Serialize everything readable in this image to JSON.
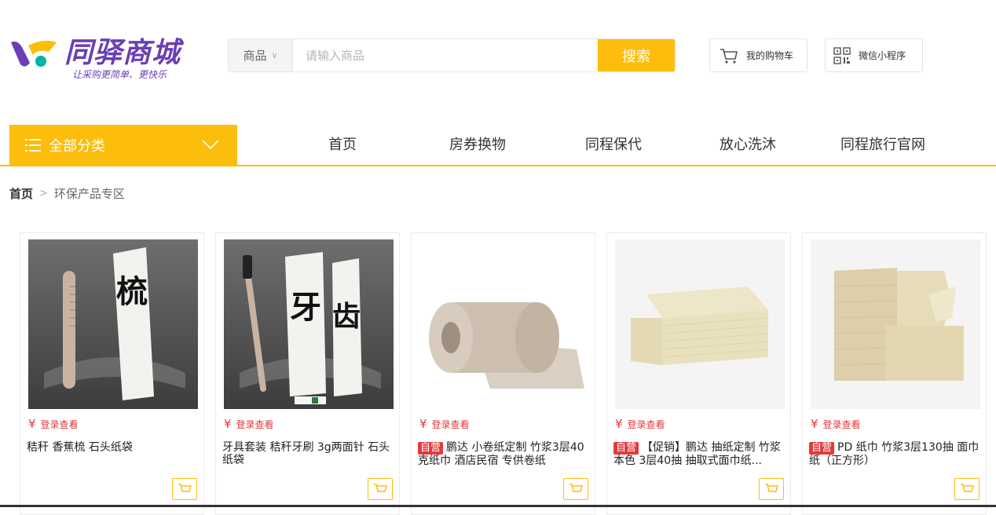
{
  "brand": {
    "name": "同驿商城",
    "slogan": "让采购更简单、更快乐"
  },
  "search": {
    "category": "商品",
    "placeholder": "请输入商品",
    "button": "搜索"
  },
  "header_buttons": {
    "cart": "我的购物车",
    "mini_program": "微信小程序"
  },
  "nav": {
    "all_categories": "全部分类",
    "links": [
      "首页",
      "房券换物",
      "同程保代",
      "放心洗沐",
      "同程旅行官网"
    ]
  },
  "breadcrumb": {
    "home": "首页",
    "current": "环保产品专区"
  },
  "products": [
    {
      "price_symbol": "¥",
      "price_text": "登录查看",
      "tag": "",
      "title": "秸秆 香蕉梳 石头纸袋",
      "image": "comb-pack"
    },
    {
      "price_symbol": "¥",
      "price_text": "登录查看",
      "tag": "",
      "title": "牙具套装 秸秆牙刷 3g两面针 石头纸袋",
      "image": "toothbrush-pack"
    },
    {
      "price_symbol": "¥",
      "price_text": "登录查看",
      "tag": "自营",
      "title": "鹏达 小卷纸定制 竹浆3层40克纸巾 酒店民宿 专供卷纸",
      "image": "toilet-roll"
    },
    {
      "price_symbol": "¥",
      "price_text": "登录查看",
      "tag": "自营",
      "title": "【促销】鹏达 抽纸定制 竹浆本色 3层40抽 抽取式面巾纸...",
      "image": "napkin-stack"
    },
    {
      "price_symbol": "¥",
      "price_text": "登录查看",
      "tag": "自营",
      "title": "PD 纸巾 竹浆3层130抽 面巾纸（正方形）",
      "image": "tissue-stack"
    }
  ],
  "colors": {
    "accent": "#fdbd0d",
    "brand": "#6a3fb5",
    "price": "#e4393c"
  }
}
